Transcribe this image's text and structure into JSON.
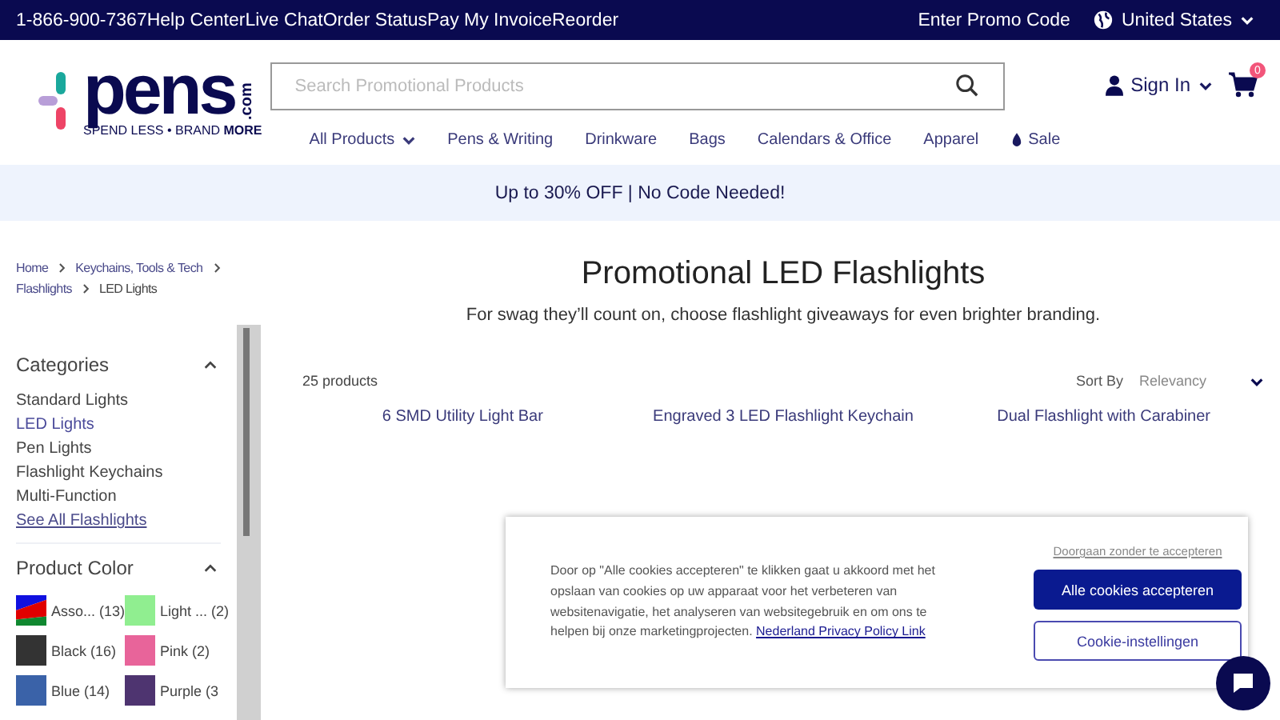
{
  "top_bar": {
    "links": [
      "1-866-900-7367",
      "Help Center",
      "Live Chat",
      "Order Status",
      "Pay My Invoice",
      "Reorder"
    ],
    "promo": "Enter Promo Code",
    "country": "United States"
  },
  "header": {
    "logo": {
      "name": "pens",
      "domain": ".com",
      "tagline": "SPEND LESS • BRAND **MORE**"
    },
    "search": {
      "placeholder": "Search Promotional Products"
    },
    "account": "Sign In",
    "cart_count": "0"
  },
  "nav": [
    {
      "label": "All Products",
      "kind": "dropdown"
    },
    {
      "label": "Pens & Writing",
      "kind": "plain"
    },
    {
      "label": "Drinkware",
      "kind": "plain"
    },
    {
      "label": "Bags",
      "kind": "plain"
    },
    {
      "label": "Calendars & Office",
      "kind": "plain"
    },
    {
      "label": "Apparel",
      "kind": "plain"
    },
    {
      "label": "Sale",
      "kind": "sale"
    }
  ],
  "promo_banner": "Up to 30% OFF | No Code Needed!",
  "breadcrumb": [
    {
      "label": "Home",
      "current": false
    },
    {
      "label": "Keychains, Tools & Tech",
      "current": false
    },
    {
      "label": "Flashlights",
      "current": false
    },
    {
      "label": "LED Lights",
      "current": true
    }
  ],
  "page": {
    "title": "Promotional LED Flashlights",
    "subtitle": "For swag they’ll count on, choose flashlight giveaways for even brighter branding."
  },
  "filters": [
    {
      "title": "Categories",
      "kind": "list",
      "expanded": true,
      "items": [
        {
          "label": "Standard Lights",
          "selected": false,
          "kind": "item"
        },
        {
          "label": "LED Lights",
          "selected": true,
          "kind": "item"
        },
        {
          "label": "Pen Lights",
          "selected": false,
          "kind": "item"
        },
        {
          "label": "Flashlight Keychains",
          "selected": false,
          "kind": "item"
        },
        {
          "label": "Multi-Function",
          "selected": false,
          "kind": "item"
        },
        {
          "label": "See All Flashlights",
          "selected": false,
          "kind": "link"
        }
      ]
    },
    {
      "title": "Product Color",
      "kind": "swatches",
      "expanded": true,
      "items": [
        {
          "label": "Asso...",
          "count": "(13)",
          "kind": "multi",
          "stripes": [
            {
              "color": "#1010e0"
            },
            {
              "color": "#e00000"
            },
            {
              "color": "#108830"
            }
          ]
        },
        {
          "label": "Light ...",
          "count": "(2)",
          "kind": "solid",
          "color": "#90ee90"
        },
        {
          "label": "Black",
          "count": "(16)",
          "kind": "solid",
          "color": "#333333"
        },
        {
          "label": "Pink",
          "count": "(2)",
          "kind": "solid",
          "color": "#e8649a"
        },
        {
          "label": "Blue",
          "count": "(14)",
          "kind": "solid",
          "color": "#3a62a8"
        },
        {
          "label": "Purple",
          "count": "(3",
          "kind": "solid",
          "color": "#4e3470"
        }
      ]
    }
  ],
  "results": {
    "count": "25 products",
    "sort_label": "Sort By",
    "sort_value": "Relevancy",
    "products": [
      "6 SMD Utility Light Bar",
      "Engraved 3 LED Flashlight Keychain",
      "Dual Flashlight with Carabiner"
    ]
  },
  "cookie_banner": {
    "text": "Door op \"Alle cookies accepteren\" te klikken gaat u akkoord met het opslaan van cookies op uw apparaat voor het verbeteren van websitenavigatie, het analyseren van websitegebruik en om ons te helpen bij onze marketingprojecten.",
    "policy_link": "Nederland Privacy Policy Link",
    "skip": "Doorgaan zonder te accepteren",
    "accept": "Alle cookies accepteren",
    "settings": "Cookie-instellingen"
  }
}
